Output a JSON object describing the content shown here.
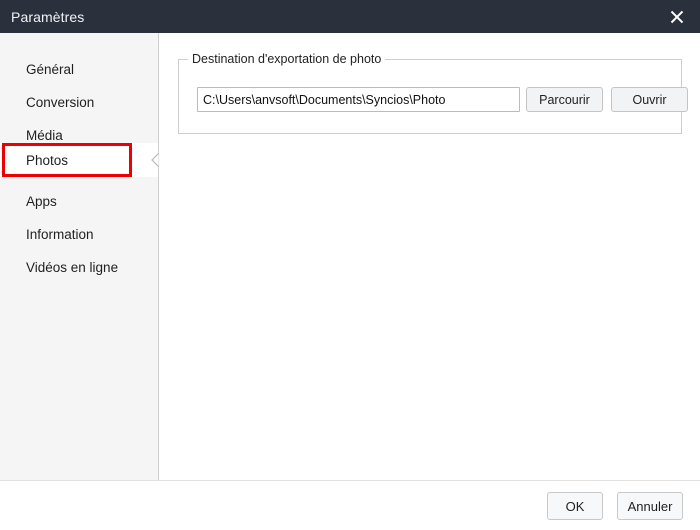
{
  "window": {
    "title": "Paramètres",
    "titlebar_bg": "#2b313c",
    "accent_highlight": "#ee0000",
    "close_icon": "close-icon"
  },
  "sidebar": {
    "items": [
      {
        "label": "Général",
        "selected": false
      },
      {
        "label": "Conversion",
        "selected": false
      },
      {
        "label": "Média",
        "selected": false
      },
      {
        "label": "Photos",
        "selected": true
      },
      {
        "label": "Apps",
        "selected": false
      },
      {
        "label": "Information",
        "selected": false
      },
      {
        "label": "Vidéos en ligne",
        "selected": false
      }
    ]
  },
  "main": {
    "groupbox": {
      "legend": "Destination d'exportation de photo",
      "path_value": "C:\\Users\\anvsoft\\Documents\\Syncios\\Photo",
      "path_placeholder": "",
      "browse_label": "Parcourir",
      "open_label": "Ouvrir"
    }
  },
  "footer": {
    "ok_label": "OK",
    "cancel_label": "Annuler"
  }
}
